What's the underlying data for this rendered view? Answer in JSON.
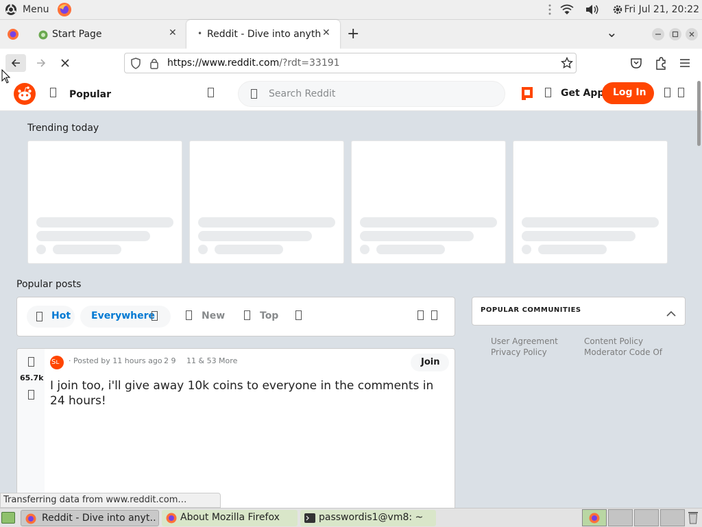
{
  "system_bar": {
    "menu_label": "Menu",
    "clock": "Fri Jul 21, 20:22"
  },
  "tabs": [
    {
      "title": "Start Page",
      "close": "✕"
    },
    {
      "title": "Reddit - Dive into anythin",
      "close": "✕",
      "loading": true
    }
  ],
  "tabbar": {
    "new_tab": "+",
    "list_tabs": "⌄"
  },
  "navbar": {
    "url_host": "https://www.reddit.com",
    "url_path": "/?rdt=33191"
  },
  "reddit_header": {
    "feed_label": "Popular",
    "search_placeholder": "Search Reddit",
    "get_app": "Get App",
    "log_in": "Log In"
  },
  "trending": {
    "title": "Trending today",
    "card_count": 4
  },
  "popular_posts": {
    "title": "Popular posts",
    "filters": {
      "hot": "Hot",
      "everywhere": "Everywhere",
      "new": "New",
      "top": "Top"
    }
  },
  "communities": {
    "title": "POPULAR COMMUNITIES",
    "links": [
      "User Agreement",
      "Content Policy",
      "Privacy Policy",
      "Moderator Code Of"
    ]
  },
  "post": {
    "votes": "65.7k",
    "meta": "· Posted by 11 hours ago",
    "awards": "2  9",
    "more": "11 & 53 More",
    "join": "Join",
    "title": "I join too, i'll give away 10k coins to everyone in the comments in 24 hours!",
    "avatar_text": "Sʟ"
  },
  "status_text": "Transferring data from www.reddit.com…",
  "taskbar": {
    "items": [
      "Reddit - Dive into anyt…",
      "About Mozilla Firefox",
      "passwordis1@vm8: ~"
    ]
  },
  "colors": {
    "reddit_orange": "#ff4500",
    "reddit_blue": "#0079d3",
    "page_bg": "#dae0e6"
  }
}
